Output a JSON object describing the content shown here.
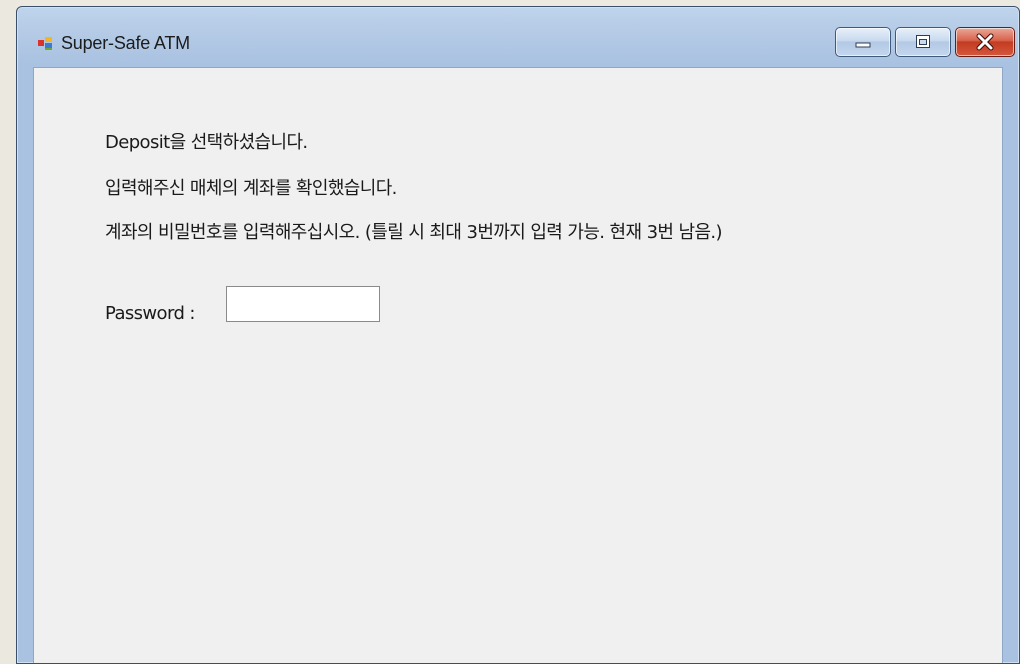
{
  "window": {
    "title": "Super-Safe ATM",
    "icon": "windows-form-icon",
    "buttons": {
      "minimize": "minimize-icon",
      "maximize": "maximize-icon",
      "close": "close-icon"
    }
  },
  "messages": {
    "line1": "Deposit을 선택하셨습니다.",
    "line2": "입력해주신 매체의 계좌를 확인했습니다.",
    "line3": "계좌의 비밀번호를 입력해주십시오. (틀릴 시 최대 3번까지 입력 가능. 현재 3번 남음.)"
  },
  "password": {
    "label": "Password :",
    "value": ""
  },
  "colors": {
    "client_background": "#f0f0f0",
    "frame": "#a9c2e1",
    "close_button": "#c23c22"
  }
}
